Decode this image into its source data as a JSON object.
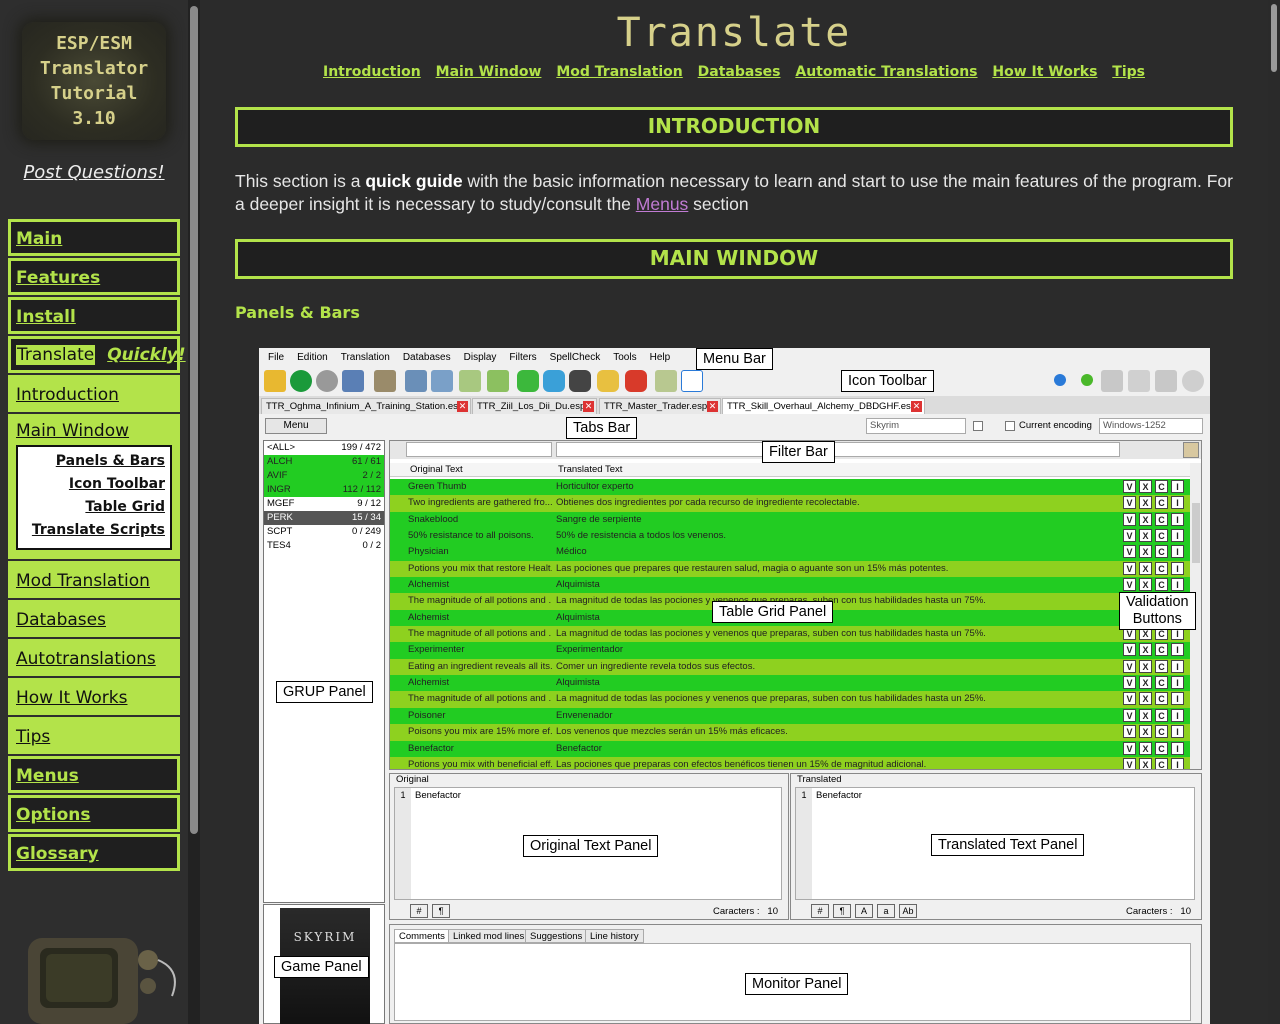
{
  "sidebar": {
    "logo_text": "ESP/ESM\nTranslator\nTutorial\n3.10",
    "post_questions": "Post Questions!",
    "nav": {
      "main": "Main",
      "features": "Features",
      "install": "Install",
      "translate": "Translate",
      "quickly": "Quickly!",
      "introduction": "Introduction",
      "main_window": "Main Window",
      "main_window_sub": [
        "Panels & Bars",
        "Icon Toolbar",
        "Table Grid",
        "Translate Scripts"
      ],
      "mod_translation": "Mod Translation",
      "databases": "Databases",
      "autotranslations": "Autotranslations",
      "how_it_works": "How It Works",
      "tips": "Tips",
      "menus": "Menus",
      "options": "Options",
      "glossary": "Glossary"
    }
  },
  "page": {
    "title": "Translate",
    "topnav": [
      "Introduction",
      "Main Window",
      "Mod Translation",
      "Databases",
      "Automatic Translations",
      "How It Works",
      "Tips"
    ],
    "intro_heading": "INTRODUCTION",
    "intro_p1": "This section is a ",
    "intro_bold": "quick guide",
    "intro_p2": " with the basic information necessary to learn and start to use the main features of the program. For a deeper insight it is necessary to study/consult the ",
    "intro_link": "Menus",
    "intro_p3": " section",
    "main_window_heading": "MAIN WINDOW",
    "panels_heading": "Panels & Bars"
  },
  "app": {
    "menus": [
      "File",
      "Edition",
      "Translation",
      "Databases",
      "Display",
      "Filters",
      "SpellCheck",
      "Tools",
      "Help"
    ],
    "tabs": [
      "TTR_Oghma_Infinium_A_Training_Station.esp",
      "TTR_Ziil_Los_Dii_Du.esp",
      "TTR_Master_Trader.esp",
      "TTR_Skill_Overhaul_Alchemy_DBDGHF.esp"
    ],
    "menu_button": "Menu",
    "game_combo": "Skyrim",
    "current_encoding": "Current encoding",
    "encoding_combo": "Windows-1252",
    "grup": [
      {
        "name": "<ALL>",
        "count": "199 / 472",
        "style": "white"
      },
      {
        "name": "ALCH",
        "count": "61 / 61",
        "style": "green"
      },
      {
        "name": "AVIF",
        "count": "2 / 2",
        "style": "green"
      },
      {
        "name": "INGR",
        "count": "112 / 112",
        "style": "green"
      },
      {
        "name": "MGEF",
        "count": "9 / 12",
        "style": "white"
      },
      {
        "name": "PERK",
        "count": "15 / 34",
        "style": "dark"
      },
      {
        "name": "SCPT",
        "count": "0 / 249",
        "style": "white"
      },
      {
        "name": "TES4",
        "count": "0 / 2",
        "style": "white"
      }
    ],
    "grid_headers": {
      "original": "Original Text",
      "translated": "Translated Text"
    },
    "grid_rows": [
      {
        "o": "Green Thumb",
        "t": "Horticultor experto",
        "s": "a"
      },
      {
        "o": "Two ingredients are gathered fro...",
        "t": "Obtienes dos ingredientes por cada recurso de ingrediente recolectable.",
        "s": "b"
      },
      {
        "o": "Snakeblood",
        "t": "Sangre de serpiente",
        "s": "a"
      },
      {
        "o": "50% resistance to all poisons.",
        "t": "50% de resistencia a todos los venenos.",
        "s": "a"
      },
      {
        "o": "Physician",
        "t": "Médico",
        "s": "a"
      },
      {
        "o": "Potions you mix that restore Healt...",
        "t": "Las pociones que prepares que restauren salud, magia o aguante son un 15% más potentes.",
        "s": "b"
      },
      {
        "o": "Alchemist",
        "t": "Alquimista",
        "s": "a"
      },
      {
        "o": "The magnitude of all potions and ...",
        "t": "La magnitud de todas las pociones y venenos que preparas, suben con tus habilidades hasta un 75%.",
        "s": "b"
      },
      {
        "o": "Alchemist",
        "t": "Alquimista",
        "s": "a"
      },
      {
        "o": "The magnitude of all potions and ...",
        "t": "La magnitud de todas las pociones y venenos que preparas, suben con tus habilidades hasta un 75%.",
        "s": "b"
      },
      {
        "o": "Experimenter",
        "t": "Experimentador",
        "s": "a"
      },
      {
        "o": "Eating an ingredient reveals all its...",
        "t": "Comer un ingrediente revela todos sus efectos.",
        "s": "b"
      },
      {
        "o": "Alchemist",
        "t": "Alquimista",
        "s": "a"
      },
      {
        "o": "The magnitude of all potions and ...",
        "t": "La magnitud de todas las pociones y venenos que preparas, suben con tus habilidades hasta un 25%.",
        "s": "b"
      },
      {
        "o": "Poisoner",
        "t": "Envenenador",
        "s": "a"
      },
      {
        "o": "Poisons you mix are 15% more ef...",
        "t": "Los venenos que mezcles serán un 15% más eficaces.",
        "s": "b"
      },
      {
        "o": "Benefactor",
        "t": "Benefactor",
        "s": "a"
      },
      {
        "o": "Potions you mix with beneficial eff...",
        "t": "Las pociones que preparas con efectos benéficos tienen un 15% de magnitud adicional.",
        "s": "b"
      }
    ],
    "validation_letters": [
      "V",
      "X",
      "C",
      "I"
    ],
    "original_label": "Original",
    "translated_label": "Translated",
    "line_no": "1",
    "panel_text": "Benefactor",
    "chars_label": "Caracters :",
    "chars_value": "10",
    "orig_foot": [
      "#",
      "¶"
    ],
    "trans_foot": [
      "#",
      "¶",
      "A",
      "a",
      "Ab"
    ],
    "monitor_tabs": [
      "Comments",
      "Linked mod lines",
      "Suggestions",
      "Line history"
    ],
    "skyrim_logo": "SKYRIM"
  },
  "callouts": {
    "menu_bar": "Menu Bar",
    "icon_toolbar": "Icon Toolbar",
    "tabs_bar": "Tabs Bar",
    "filter_bar": "Filter Bar",
    "table_grid_panel": "Table Grid Panel",
    "validation_buttons": "Validation\nButtons",
    "grup_panel": "GRUP Panel",
    "original_text_panel": "Original Text Panel",
    "translated_text_panel": "Translated Text Panel",
    "game_panel": "Game Panel",
    "monitor_panel": "Monitor Panel"
  },
  "colors": {
    "accent": "#b3e34a",
    "title": "#d6d08a",
    "background": "#2b2b2b",
    "link_visited": "#c07bd3",
    "grid_green": "#22cc22",
    "grid_yellowgreen": "#8ed11f"
  }
}
